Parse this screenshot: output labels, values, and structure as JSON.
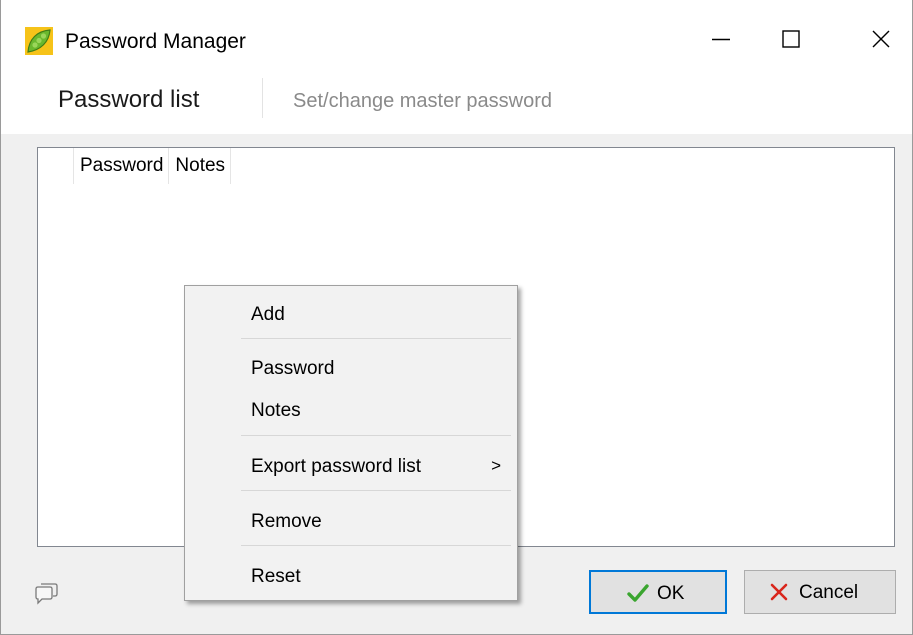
{
  "window": {
    "title": "Password Manager",
    "app_icon": "pea-pod-icon",
    "controls": {
      "minimize": "minimize-icon",
      "maximize": "maximize-icon",
      "close": "close-icon"
    }
  },
  "tabs": [
    {
      "label": "Password list",
      "active": true
    },
    {
      "label": "Set/change master password",
      "active": false
    }
  ],
  "list": {
    "columns": [
      "Password",
      "Notes"
    ]
  },
  "context_menu": {
    "items": [
      {
        "label": "Add"
      },
      {
        "label": "Password"
      },
      {
        "label": "Notes"
      },
      {
        "label": "Export password list",
        "has_submenu": true,
        "submenu_arrow": ">"
      },
      {
        "label": "Remove"
      },
      {
        "label": "Reset"
      }
    ]
  },
  "footer": {
    "help_icon": "speech-bubble-icon",
    "ok_label": "OK",
    "cancel_label": "Cancel",
    "ok_icon": "checkmark-icon",
    "cancel_icon": "x-icon"
  },
  "colors": {
    "accent": "#0078d7",
    "ok_check": "#3aa52f",
    "cancel_x": "#d9261c",
    "app_icon_green": "#6ab82e"
  }
}
